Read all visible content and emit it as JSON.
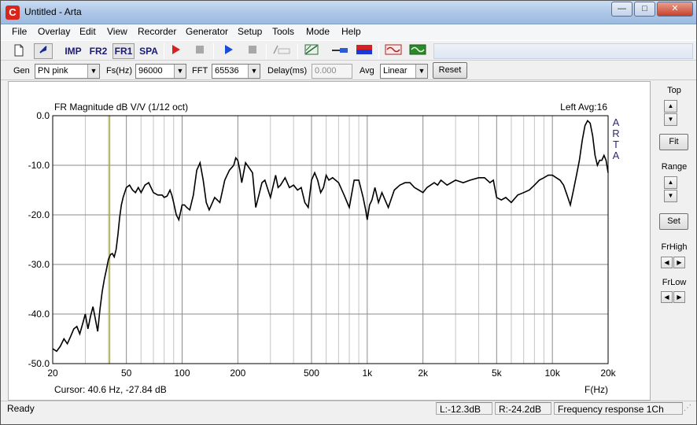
{
  "window": {
    "title": "Untitled - Arta",
    "app_icon_glyph": "C"
  },
  "menu": [
    "File",
    "Overlay",
    "Edit",
    "View",
    "Recorder",
    "Generator",
    "Setup",
    "Tools",
    "Mode",
    "Help"
  ],
  "toolbar": {
    "imp_label": "IMP",
    "fr2_label": "FR2",
    "fr1_label": "FR1",
    "spa_label": "SPA"
  },
  "options": {
    "gen_label": "Gen",
    "gen_value": "PN pink",
    "fs_label": "Fs(Hz)",
    "fs_value": "96000",
    "fft_label": "FFT",
    "fft_value": "65536",
    "delay_label": "Delay(ms)",
    "delay_value": "0.000",
    "avg_label": "Avg",
    "avg_value": "Linear",
    "reset_label": "Reset"
  },
  "right_panel": {
    "top_label": "Top",
    "fit_label": "Fit",
    "range_label": "Range",
    "set_label": "Set",
    "frhigh_label": "FrHigh",
    "frlow_label": "FrLow"
  },
  "plot": {
    "title": "FR Magnitude dB V/V (1/12 oct)",
    "channel_info": "Left  Avg:16",
    "watermark": [
      "A",
      "R",
      "T",
      "A"
    ],
    "cursor_text": "Cursor:    40.6 Hz, -27.84 dB",
    "x_unit_label": "F(Hz)",
    "cursor_freq_hz": 40.6,
    "line_color": "#000000",
    "cursor_color": "#b5b500"
  },
  "chart_data": {
    "type": "line",
    "title": "FR Magnitude dB V/V (1/12 oct)",
    "xlabel": "F(Hz)",
    "ylabel": "",
    "x_scale": "log",
    "xlim": [
      20,
      20000
    ],
    "ylim": [
      -50,
      0
    ],
    "grid": true,
    "x_ticks": [
      20,
      50,
      100,
      200,
      500,
      1000,
      2000,
      5000,
      10000,
      20000
    ],
    "x_tick_labels": [
      "20",
      "50",
      "100",
      "200",
      "500",
      "1k",
      "2k",
      "5k",
      "10k",
      "20k"
    ],
    "y_ticks": [
      0,
      -10,
      -20,
      -30,
      -40,
      -50
    ],
    "y_tick_labels": [
      "0.0",
      "-10.0",
      "-20.0",
      "-30.0",
      "-40.0",
      "-50.0"
    ],
    "series": [
      {
        "x": [
          20,
          21,
          22,
          23,
          24,
          25,
          26,
          27,
          28,
          29,
          30,
          31,
          32,
          33,
          34,
          35,
          36,
          37,
          38,
          39,
          40,
          41,
          42,
          43,
          44,
          45,
          46,
          47,
          48,
          50,
          52,
          54,
          56,
          58,
          60,
          63,
          66,
          70,
          74,
          78,
          80,
          83,
          86,
          88,
          90,
          93,
          96,
          100,
          103,
          106,
          110,
          115,
          120,
          125,
          130,
          135,
          140,
          150,
          160,
          170,
          180,
          190,
          195,
          200,
          205,
          210,
          220,
          230,
          240,
          250,
          260,
          270,
          280,
          300,
          320,
          330,
          340,
          360,
          380,
          400,
          420,
          440,
          460,
          480,
          500,
          520,
          540,
          560,
          580,
          600,
          620,
          650,
          700,
          750,
          800,
          850,
          900,
          950,
          980,
          1000,
          1030,
          1060,
          1100,
          1150,
          1200,
          1300,
          1400,
          1500,
          1600,
          1700,
          1800,
          1900,
          2000,
          2100,
          2200,
          2300,
          2400,
          2500,
          2700,
          3000,
          3300,
          3600,
          4000,
          4300,
          4600,
          4800,
          5000,
          5300,
          5600,
          6000,
          6500,
          7000,
          7500,
          8000,
          8500,
          9000,
          9500,
          10000,
          10500,
          11000,
          11500,
          12000,
          12500,
          13000,
          13500,
          14000,
          14500,
          15000,
          15500,
          16000,
          16500,
          17000,
          17500,
          18000,
          18500,
          19000,
          19500,
          20000
        ],
        "y": [
          -47.0,
          -47.5,
          -46.5,
          -45.0,
          -46.0,
          -44.5,
          -43.0,
          -42.5,
          -44.0,
          -42.0,
          -40.0,
          -43.0,
          -40.5,
          -38.5,
          -41.0,
          -43.5,
          -39.0,
          -35.5,
          -33.0,
          -31.0,
          -29.0,
          -28.0,
          -27.8,
          -28.5,
          -27.0,
          -24.0,
          -20.5,
          -18.0,
          -16.5,
          -14.5,
          -14.0,
          -15.0,
          -15.5,
          -14.5,
          -15.5,
          -14.0,
          -13.5,
          -15.5,
          -16.0,
          -16.0,
          -16.5,
          -16.2,
          -15.0,
          -16.0,
          -17.5,
          -20.0,
          -21.0,
          -18.0,
          -18.0,
          -18.5,
          -19.0,
          -16.0,
          -11.0,
          -9.5,
          -13.0,
          -17.5,
          -19.0,
          -16.5,
          -17.5,
          -13.0,
          -11.0,
          -10.0,
          -8.5,
          -9.0,
          -11.0,
          -13.5,
          -9.5,
          -10.5,
          -11.5,
          -18.5,
          -16.0,
          -13.5,
          -13.0,
          -16.5,
          -12.0,
          -14.5,
          -14.0,
          -12.5,
          -14.5,
          -14.0,
          -15.0,
          -14.5,
          -17.5,
          -18.5,
          -13.0,
          -11.5,
          -13.0,
          -15.5,
          -14.5,
          -12.0,
          -13.0,
          -12.5,
          -13.5,
          -16.0,
          -18.5,
          -13.0,
          -13.0,
          -16.5,
          -19.0,
          -21.0,
          -18.0,
          -17.0,
          -14.5,
          -17.5,
          -15.5,
          -18.5,
          -15.0,
          -14.0,
          -13.5,
          -13.5,
          -14.5,
          -15.0,
          -15.5,
          -14.5,
          -14.0,
          -13.5,
          -14.0,
          -13.0,
          -14.0,
          -13.0,
          -13.5,
          -13.0,
          -12.5,
          -12.5,
          -13.5,
          -13.0,
          -16.5,
          -17.0,
          -16.5,
          -17.5,
          -16.0,
          -15.5,
          -15.0,
          -14.0,
          -13.0,
          -12.5,
          -12.0,
          -12.0,
          -12.5,
          -13.0,
          -14.0,
          -16.0,
          -18.0,
          -15.0,
          -12.0,
          -9.0,
          -5.0,
          -2.0,
          -1.0,
          -1.5,
          -4.0,
          -8.0,
          -10.0,
          -9.0,
          -9.0,
          -8.0,
          -9.0,
          -11.5
        ]
      }
    ]
  },
  "status": {
    "state": "Ready",
    "left_level": "L:-12.3dB",
    "right_level": "R:-24.2dB",
    "mode": "Frequency response 1Ch"
  }
}
